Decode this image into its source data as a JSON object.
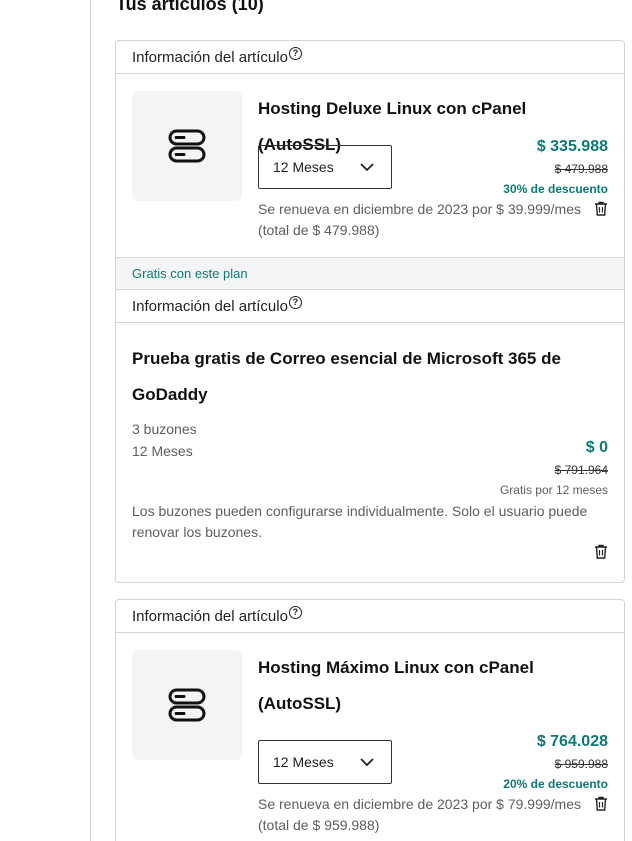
{
  "page": {
    "heading": "Tus artículos (10)"
  },
  "items": [
    {
      "header": "Información del artículo",
      "info_icon": "?",
      "title": "Hosting Deluxe Linux con cPanel (AutoSSL)",
      "term": "12 Meses",
      "price": "$ 335.988",
      "old_price": "$ 479.988",
      "discount": "30% de descuento",
      "renew": "Se renueva en diciembre de 2023 por $ 39.999/mes (total de $ 479.988)",
      "icon": "server-icon"
    },
    {
      "band": "Gratis con este plan",
      "header": "Información del artículo",
      "info_icon": "?",
      "title_line1": "Prueba gratis de Correo esencial de Microsoft 365 de",
      "title_line2": "GoDaddy",
      "mailboxes": "3 buzones",
      "term": "12 Meses",
      "price": "$ 0",
      "old_price": "$ 791.964",
      "free_note": "Gratis por 12 meses",
      "description": "Los buzones pueden configurarse individualmente. Solo el usuario puede renovar los buzones."
    },
    {
      "header": "Información del artículo",
      "info_icon": "?",
      "title_line1": "Hosting Máximo Linux con cPanel",
      "title_line2": "(AutoSSL)",
      "term": "12 Meses",
      "price": "$ 764.028",
      "old_price": "$ 959.988",
      "discount": "20% de descuento",
      "renew": "Se renueva en diciembre de 2023 por $ 79.999/mes (total de $ 959.988)",
      "icon": "server-icon"
    }
  ],
  "colors": {
    "accent": "#0b7a75",
    "border": "#d4d4d4",
    "thumb_bg": "#f4f4f5"
  },
  "icons": [
    "server-icon",
    "chevron-down-icon",
    "trash-icon",
    "info-icon"
  ]
}
